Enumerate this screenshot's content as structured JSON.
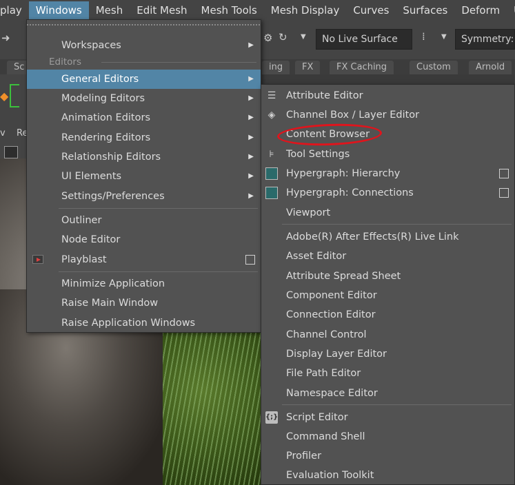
{
  "menubar": {
    "items": [
      "play",
      "Windows",
      "Mesh",
      "Edit Mesh",
      "Mesh Tools",
      "Mesh Display",
      "Curves",
      "Surfaces",
      "Deform",
      "U"
    ],
    "active_index": 1
  },
  "toolbar": {
    "live_surface": "No Live Surface",
    "symmetry": "Symmetry: C"
  },
  "shelf_tabs": [
    "Sc",
    "ing",
    "FX",
    "FX Caching",
    "Custom",
    "Arnold"
  ],
  "left_labels": [
    "v",
    "Re"
  ],
  "windows_menu": {
    "workspaces": "Workspaces",
    "section_editors": "Editors",
    "general_editors": "General Editors",
    "modeling_editors": "Modeling Editors",
    "animation_editors": "Animation Editors",
    "rendering_editors": "Rendering Editors",
    "relationship_editors": "Relationship Editors",
    "ui_elements": "UI Elements",
    "settings_preferences": "Settings/Preferences",
    "outliner": "Outliner",
    "node_editor": "Node Editor",
    "playblast": "Playblast",
    "minimize_application": "Minimize Application",
    "raise_main_window": "Raise Main Window",
    "raise_application_windows": "Raise Application Windows"
  },
  "general_editors": {
    "attribute_editor": "Attribute Editor",
    "channel_box": "Channel Box / Layer Editor",
    "content_browser": "Content Browser",
    "tool_settings": "Tool Settings",
    "hypergraph_hierarchy": "Hypergraph: Hierarchy",
    "hypergraph_connections": "Hypergraph: Connections",
    "viewport": "Viewport",
    "after_effects_link": "Adobe(R) After Effects(R) Live Link",
    "asset_editor": "Asset Editor",
    "attribute_spread_sheet": "Attribute Spread Sheet",
    "component_editor": "Component Editor",
    "connection_editor": "Connection Editor",
    "channel_control": "Channel Control",
    "display_layer_editor": "Display Layer Editor",
    "file_path_editor": "File Path Editor",
    "namespace_editor": "Namespace Editor",
    "script_editor": "Script Editor",
    "command_shell": "Command Shell",
    "profiler": "Profiler",
    "evaluation_toolkit": "Evaluation Toolkit"
  },
  "colors": {
    "highlight": "#5285a6",
    "menu_bg": "#525252",
    "annotation": "#e0141c"
  }
}
